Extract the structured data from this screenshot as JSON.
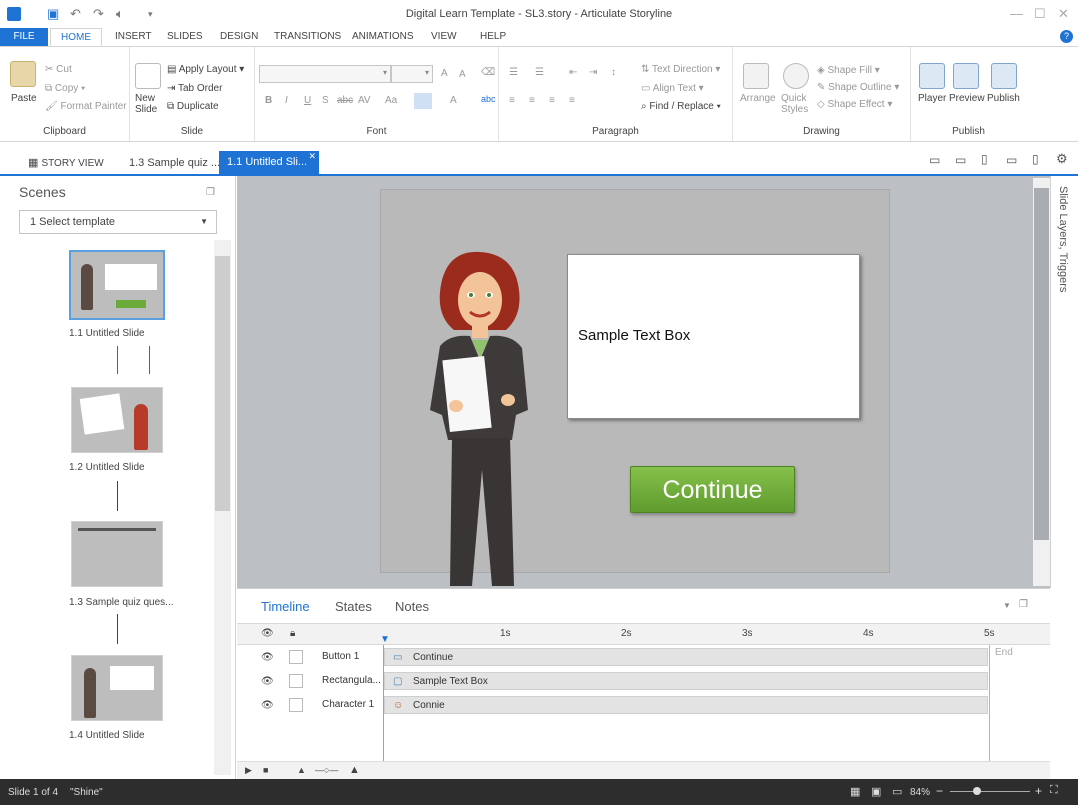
{
  "window": {
    "title": "Digital Learn Template - SL3.story - Articulate Storyline",
    "minimize_glyph": "—",
    "maximize_glyph": "☐",
    "close_glyph": "✕"
  },
  "quick_access": {
    "save_icon": "save-icon",
    "undo_icon": "undo-icon",
    "redo_icon": "redo-icon",
    "audio_icon": "speaker-icon"
  },
  "menu": {
    "file": "FILE",
    "items": [
      "HOME",
      "INSERT",
      "SLIDES",
      "DESIGN",
      "TRANSITIONS",
      "ANIMATIONS",
      "VIEW",
      "HELP"
    ]
  },
  "ribbon": {
    "clipboard": {
      "label": "Clipboard",
      "paste": "Paste",
      "cut": "Cut",
      "copy": "Copy",
      "format_painter": "Format Painter"
    },
    "slide": {
      "label": "Slide",
      "new_slide": "New Slide",
      "apply_layout": "Apply Layout",
      "tab_order": "Tab Order",
      "duplicate": "Duplicate"
    },
    "font": {
      "label": "Font",
      "bold": "B",
      "italic": "I",
      "underline": "U",
      "strike": "S",
      "abc": "abc",
      "av": "AV",
      "aa": "Aa",
      "font_color": "A"
    },
    "paragraph": {
      "label": "Paragraph",
      "text_direction": "Text Direction",
      "align_text": "Align Text",
      "find_replace": "Find / Replace"
    },
    "drawing": {
      "label": "Drawing",
      "arrange": "Arrange",
      "quick_styles": "Quick Styles",
      "shape_fill": "Shape Fill",
      "shape_outline": "Shape Outline",
      "shape_effect": "Shape Effect"
    },
    "publish": {
      "label": "Publish",
      "player": "Player",
      "preview": "Preview",
      "publish": "Publish"
    }
  },
  "tabs": {
    "story_view": "STORY VIEW",
    "tab1": "1.3 Sample quiz ...",
    "tab2": "1.1 Untitled Sli..."
  },
  "scenes": {
    "title": "Scenes",
    "selected": "1 Select template",
    "slides": [
      {
        "label": "1.1 Untitled Slide"
      },
      {
        "label": "1.2 Untitled Slide"
      },
      {
        "label": "1.3 Sample quiz ques..."
      },
      {
        "label": "1.4 Untitled Slide"
      }
    ]
  },
  "slide": {
    "text_box": "Sample Text Box",
    "continue_button": "Continue"
  },
  "right_panel": {
    "label": "Slide Layers, Triggers"
  },
  "timeline": {
    "tabs": [
      "Timeline",
      "States",
      "Notes"
    ],
    "ticks": [
      "1s",
      "2s",
      "3s",
      "4s",
      "5s"
    ],
    "end_label": "End",
    "rows": [
      {
        "name": "Button 1",
        "object": "Continue"
      },
      {
        "name": "Rectangula...",
        "object": "Sample Text Box"
      },
      {
        "name": "Character 1",
        "object": "Connie"
      }
    ]
  },
  "status": {
    "slide_count": "Slide 1 of 4",
    "theme": "\"Shine\"",
    "zoom": "84%"
  }
}
